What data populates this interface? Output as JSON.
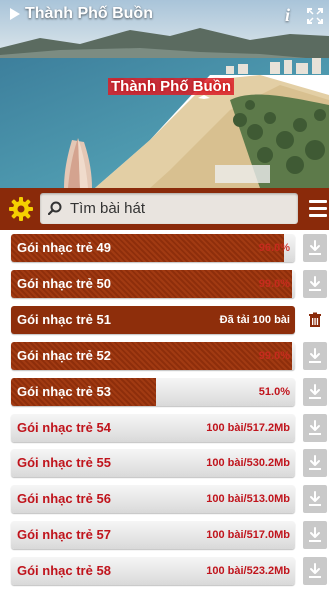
{
  "banner": {
    "title": "Thành Phố Buồn",
    "center_title": "Thành Phố Buồn",
    "info_label": "i"
  },
  "search": {
    "placeholder": "Tìm bài hát"
  },
  "packages": [
    {
      "name": "Gói nhạc trẻ 49",
      "info": "96.0%",
      "progress": 0.96,
      "state": "downloading",
      "action": "download-icon"
    },
    {
      "name": "Gói nhạc trẻ 50",
      "info": "99.0%",
      "progress": 0.99,
      "state": "downloading",
      "action": "download-icon"
    },
    {
      "name": "Gói nhạc trẻ 51",
      "info": "Đã tải 100 bài",
      "progress": 1.0,
      "state": "done",
      "action": "trash-icon"
    },
    {
      "name": "Gói nhạc trẻ 52",
      "info": "99.0%",
      "progress": 0.99,
      "state": "downloading",
      "action": "download-icon"
    },
    {
      "name": "Gói nhạc trẻ 53",
      "info": "51.0%",
      "progress": 0.51,
      "state": "downloading",
      "action": "download-icon"
    },
    {
      "name": "Gói nhạc trẻ 54",
      "info": "100 bài/517.2Mb",
      "progress": 0,
      "state": "idle",
      "action": "download-icon"
    },
    {
      "name": "Gói nhạc trẻ 55",
      "info": "100 bài/530.2Mb",
      "progress": 0,
      "state": "idle",
      "action": "download-icon"
    },
    {
      "name": "Gói nhạc trẻ 56",
      "info": "100 bài/513.0Mb",
      "progress": 0,
      "state": "idle",
      "action": "download-icon"
    },
    {
      "name": "Gói nhạc trẻ 57",
      "info": "100 bài/517.0Mb",
      "progress": 0,
      "state": "idle",
      "action": "download-icon"
    },
    {
      "name": "Gói nhạc trẻ 58",
      "info": "100 bài/523.2Mb",
      "progress": 0,
      "state": "idle",
      "action": "download-icon"
    }
  ],
  "colors": {
    "accent": "#8e2e0b",
    "text_red": "#c0141c",
    "gear": "#f5d000"
  }
}
